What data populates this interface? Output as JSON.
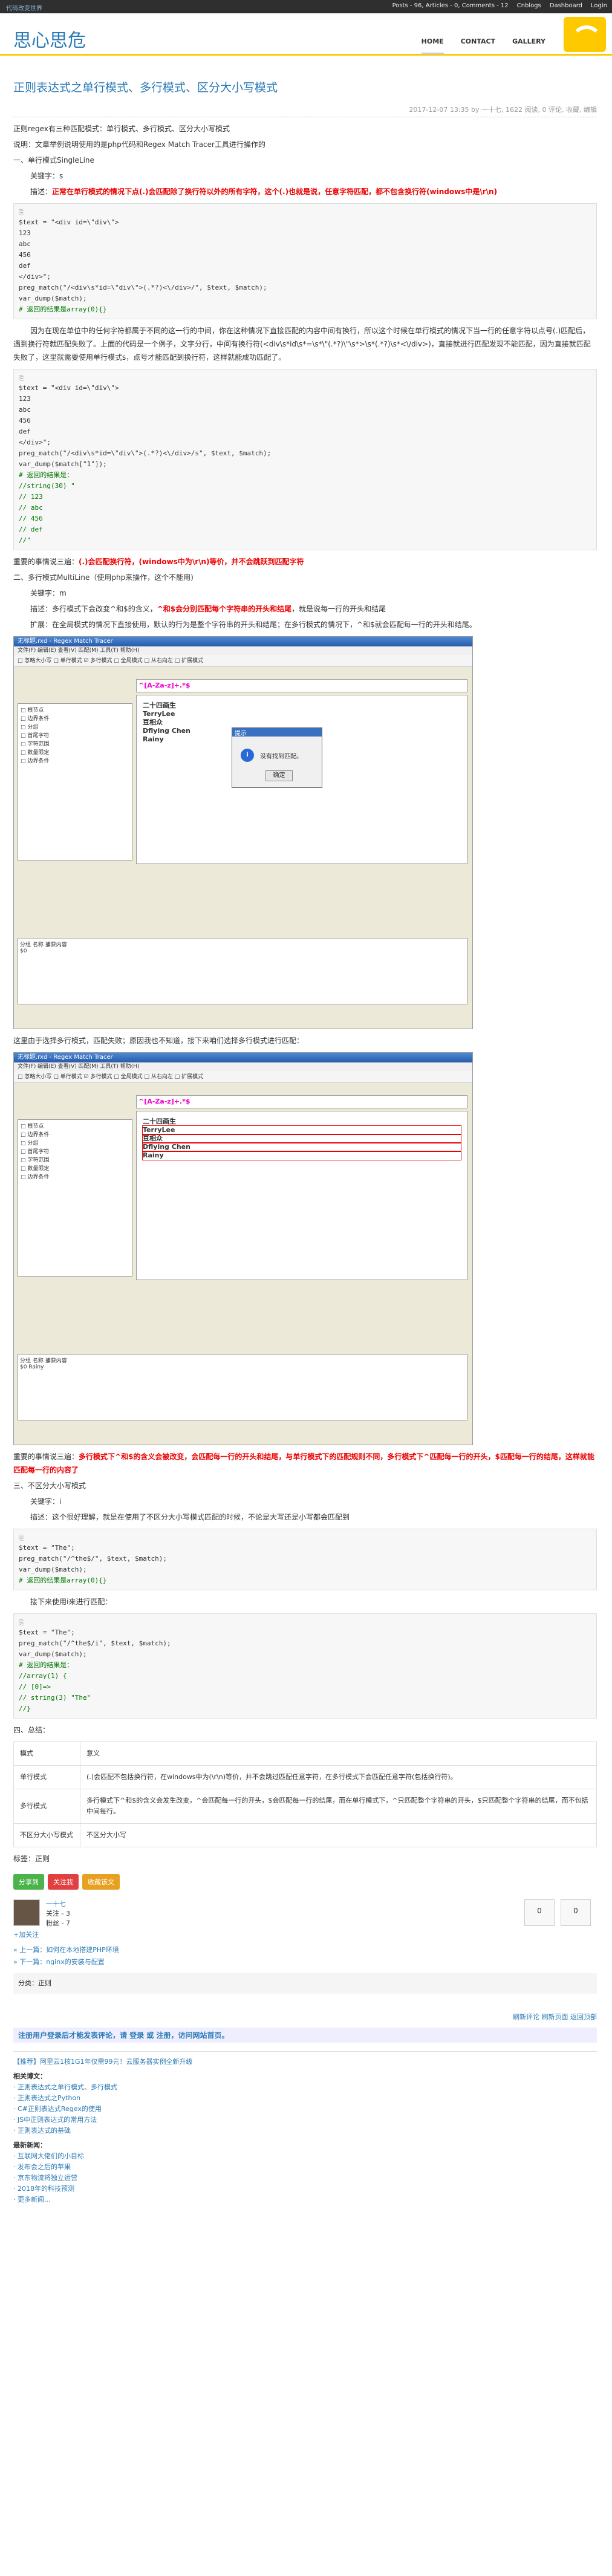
{
  "topbar": {
    "brand": "代码改变世界",
    "nav": [
      "Posts - 96, Articles - 0, Comments - 12",
      "Cnblogs",
      "Dashboard",
      "Login"
    ]
  },
  "site": {
    "name": "思心思危",
    "menu": [
      "HOME",
      "CONTACT",
      "GALLERY"
    ]
  },
  "post": {
    "title": "正则表达式之单行模式、多行模式、区分大小写模式",
    "meta": "2017-12-07 13:35 by 一十七, 1622 阅读, 0 评论, 收藏, 编辑",
    "intro1": "正则regex有三种匹配模式：单行模式、多行模式、区分大小写模式",
    "intro2": "说明：文章举例说明使用的是php代码和Regex Match Tracer工具进行操作的",
    "s1": "一、单行模式SingleLine",
    "s1a": "关键字：s",
    "s1b_label": "描述：",
    "s1b_red": "正常在单行模式的情况下点(.)会匹配除了换行符以外的所有字符，这个(.)也就是说，任意字符匹配，都不包含换行符(windows中是\\r\\n)",
    "code1": [
      "$text = \"<div id=\\\"div\\\">",
      "  123",
      "  abc",
      "  456",
      "  def",
      "</div>\";",
      "preg_match(\"/<div\\s*id=\\\"div\\\">(.*?)<\\/div>/\", $text, $match);",
      "var_dump($match);",
      "# 返回的结果是array(0){}"
    ],
    "p1": "因为在现在单位中的任何字符都属于不同的这一行的中间，你在这种情况下直接匹配的内容中间有换行，所以这个时候在单行模式的情况下当一行的任意字符以点号(.)匹配后，遇到换行符就匹配失败了。上面的代码是一个例子，文字分行，中间有换行符(<div\\s*id\\s*=\\s*\\\"(.*?)\\\"\\s*>\\s*(.*?)\\s*<\\/div>)，直接就进行匹配发现不能匹配，因为直接就匹配失败了，这里就需要使用单行模式s，点号才能匹配到换行符，这样就能成功匹配了。",
    "code2": [
      "$text = \"<div id=\\\"div\\\">",
      "  123",
      "  abc",
      "  456",
      "  def",
      "</div>\";",
      "preg_match(\"/<div\\s*id=\\\"div\\\">(.*?)<\\/div>/s\", $text, $match);",
      "var_dump($match[\"1\"]);",
      "# 返回的结果是：",
      "//string(30) \"",
      "//   123",
      "//   abc",
      "//   456",
      "//   def",
      "//\""
    ],
    "note1_prefix": "重要的事情说三遍：",
    "note1_red": "(.)会匹配换行符，(windows中为\\r\\n)等价，并不会跳跃到匹配字符",
    "s2": "二、多行模式MultiLine（使用php来操作，这个不能用)",
    "s2a": "关键字：m",
    "s2b_label": "描述：多行模式下会改变^和$的含义，",
    "s2b_red": "^和$会分别匹配每个字符串的开头和结尾",
    "s2b_rest": "，就是说每一行的开头和结尾",
    "s2c": "扩展：在全局模式的情况下直接使用，默认的行为是整个字符串的开头和结尾；在多行模式的情况下，^和$就会匹配每一行的开头和结尾。",
    "tool_title": "无标题.rxd - Regex Match Tracer",
    "tool_menu": "文件(F)  编辑(E)  查看(V)  匹配(M)  工具(T)  帮助(H)",
    "tool_opts": "□ 忽略大小写  □ 单行模式  ☑ 多行模式  □ 全局模式  □ 从右向左  □ 扩展模式",
    "tool_regex": "^[A-Za-z]+.*$",
    "tool_text": [
      "二十四画生",
      "TerryLee",
      "豆相众",
      "Dflying Chen",
      "Rainy"
    ],
    "tree": [
      "□ 根节点",
      "  □ 边界条件",
      "  □ 分组",
      "  □ 首尾字符",
      "  □ 字符范围",
      "  □ 数量限定",
      "  □ 边界条件"
    ],
    "dlg_title": "提示",
    "dlg_msg": "没有找到匹配。",
    "dlg_ok": "确定",
    "res_head": "分组  名称  捕获内容",
    "res1": "$0",
    "res2": "$0   Rainy",
    "p2": "这里由于选择多行模式，匹配失败；原因我也不知道，接下来咱们选择多行模式进行匹配：",
    "note2_prefix": "重要的事情说三遍：",
    "note2_red": "多行模式下^和$的含义会被改变，会匹配每一行的开头和结尾，与单行模式下的匹配规则不同，多行模式下^匹配每一行的开头，$匹配每一行的结尾，这样就能匹配每一行的内容了",
    "s3": "三、不区分大小写模式",
    "s3a": "关键字：i",
    "s3b": "描述：这个很好理解，就是在使用了不区分大小写模式匹配的时候，不论是大写还是小写都会匹配到",
    "code3": [
      "$text = \"The\";",
      "preg_match(\"/^the$/\", $text, $match);",
      "var_dump($match);",
      "# 返回的结果是array(0){}"
    ],
    "p3": "接下来使用i来进行匹配：",
    "code4": [
      "$text = \"The\";",
      "preg_match(\"/^the$/i\", $text, $match);",
      "var_dump($match);",
      "# 返回的结果是：",
      "//array(1) {",
      "//   [0]=>",
      "//   string(3) \"The\"",
      "//}"
    ],
    "s4": "四、总结：",
    "table": [
      [
        "模式",
        "意义"
      ],
      [
        "单行模式",
        "(.)会匹配不包括换行符，在windows中为(\\r\\n)等价，并不会跳过匹配任意字符，在多行模式下会匹配任意字符(包括换行符)。"
      ],
      [
        "多行模式",
        "多行模式下^和$的含义会发生改变，^会匹配每一行的开头，$会匹配每一行的结尾，而在单行模式下，^只匹配整个字符串的开头，$只匹配整个字符串的结尾，而不包括中间每行。"
      ],
      [
        "不区分大小写模式",
        "不区分大小写"
      ]
    ],
    "tags": "标签：正则"
  },
  "share": [
    {
      "label": "分享到",
      "color": "#4ab34a"
    },
    {
      "label": "关注我",
      "color": "#e24040"
    },
    {
      "label": "收藏该文",
      "color": "#e8a020"
    }
  ],
  "author": {
    "name": "一十七",
    "follow": "关注 - 3",
    "fans": "粉丝 - 7",
    "add": "+加关注"
  },
  "vote": {
    "up": "0",
    "down": "0"
  },
  "nav": {
    "prev": "« 上一篇：如何在本地搭建PHP环境",
    "next": "» 下一篇：nginx的安装与配置"
  },
  "category": "分类：正则",
  "comment_links": "刷新评论   刷新页面   返回顶部",
  "comment_notice": "注册用户登录后才能发表评论，请 登录 或 注册，访问网站首页。",
  "ad": "【推荐】阿里云1核1G1年仅需99元！云服务器实例全新升级",
  "related_title": "相关博文：",
  "related": [
    "正则表达式之单行模式、多行模式",
    "正则表达式之Python",
    "C#正则表达式Regex的使用",
    "JS中正则表达式的常用方法",
    "正则表达式的基础"
  ],
  "news_title": "最新新闻：",
  "news": [
    "互联网大佬们的小目标",
    "发布会之后的苹果",
    "京东物流将独立运营",
    "2018年的科技预测",
    "更多新闻..."
  ]
}
